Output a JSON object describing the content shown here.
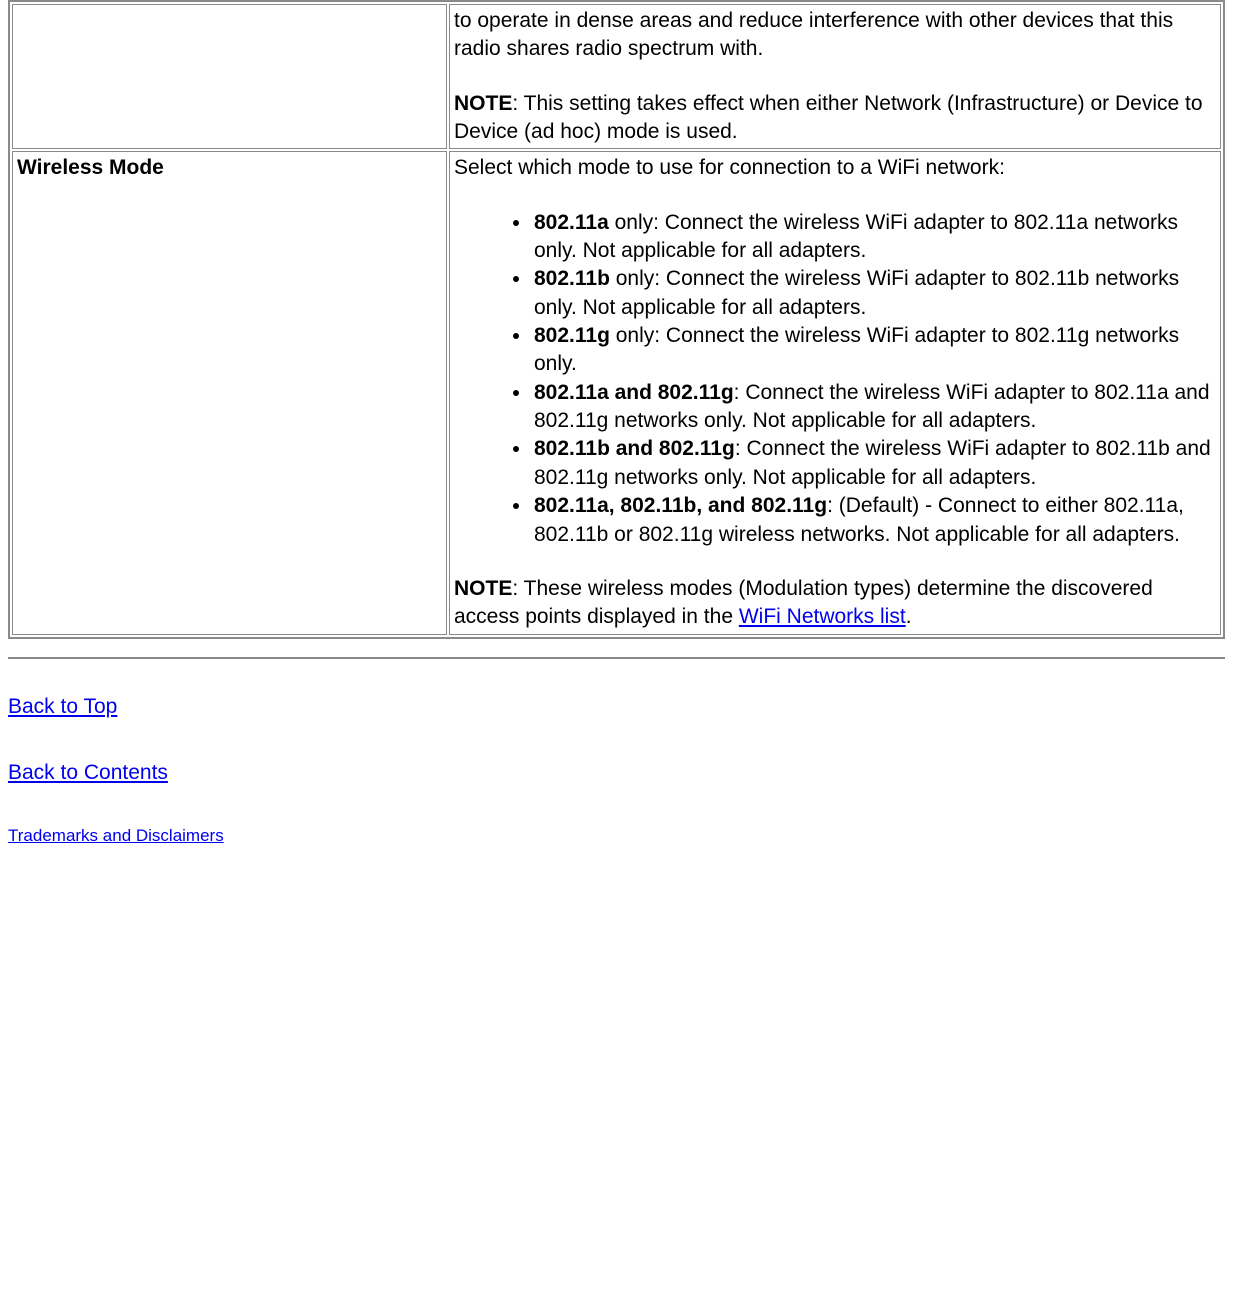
{
  "rows": {
    "tx_power": {
      "name": "",
      "desc_p1": "to operate in dense areas and reduce interference with other devices that this radio shares radio spectrum with.",
      "note_label": "NOTE",
      "note_text": ": This setting takes effect when either Network (Infrastructure) or Device to Device (ad hoc) mode is used."
    },
    "wireless_mode": {
      "name": "Wireless Mode",
      "intro": "Select which mode to use for connection to a WiFi network:",
      "options": [
        {
          "name": "802.11a",
          "text": " only: Connect the wireless WiFi adapter to 802.11a networks only. Not applicable for all adapters."
        },
        {
          "name": "802.11b",
          "text": " only: Connect the wireless WiFi adapter to 802.11b networks only. Not applicable for all adapters."
        },
        {
          "name": "802.11g",
          "text": " only: Connect the wireless WiFi adapter to 802.11g networks only."
        },
        {
          "name": "802.11a and 802.11g",
          "text": ": Connect the wireless WiFi adapter to 802.11a and 802.11g networks only. Not applicable for all adapters."
        },
        {
          "name": "802.11b and 802.11g",
          "text": ": Connect the wireless WiFi adapter to 802.11b and 802.11g networks only. Not applicable for all adapters."
        },
        {
          "name": "802.11a, 802.11b, and 802.11g",
          "text": ": (Default) - Connect to either 802.11a, 802.11b or 802.11g wireless networks. Not applicable for all adapters."
        }
      ],
      "note_label": "NOTE",
      "note_pre": ": These wireless modes (Modulation types) determine the discovered access points displayed in the ",
      "note_link": "WiFi Networks list",
      "note_post": "."
    }
  },
  "footer": {
    "back_to_top": "Back to Top",
    "back_to_contents": "Back to Contents",
    "trademarks": "Trademarks and Disclaimers"
  }
}
